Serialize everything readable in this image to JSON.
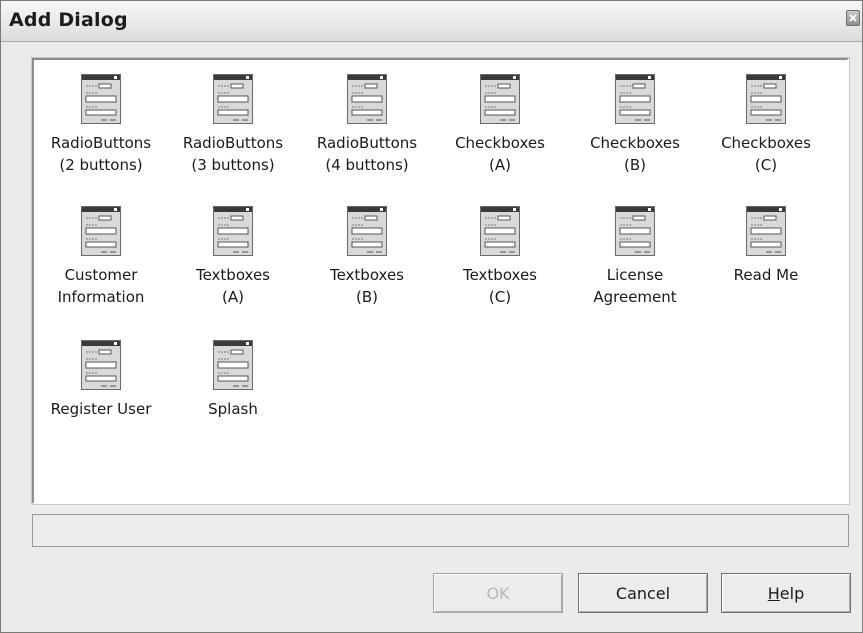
{
  "window": {
    "title": "Add Dialog"
  },
  "items": [
    {
      "label": "RadioButtons\n(2 buttons)"
    },
    {
      "label": "RadioButtons\n(3 buttons)"
    },
    {
      "label": "RadioButtons\n(4 buttons)"
    },
    {
      "label": "Checkboxes\n(A)"
    },
    {
      "label": "Checkboxes\n(B)"
    },
    {
      "label": "Checkboxes\n(C)"
    },
    {
      "label": "Customer\nInformation"
    },
    {
      "label": "Textboxes\n(A)"
    },
    {
      "label": "Textboxes\n(B)"
    },
    {
      "label": "Textboxes\n(C)"
    },
    {
      "label": "License\nAgreement"
    },
    {
      "label": "Read Me"
    },
    {
      "label": "Register User"
    },
    {
      "label": "Splash"
    }
  ],
  "buttons": {
    "ok": "OK",
    "cancel": "Cancel",
    "help_mnemonic": "H",
    "help_rest": "elp"
  },
  "colors": {
    "icon_titlebar": "#3a3a3a",
    "icon_body": "#d9d9d9",
    "disabled_text": "#b8b8b8"
  }
}
